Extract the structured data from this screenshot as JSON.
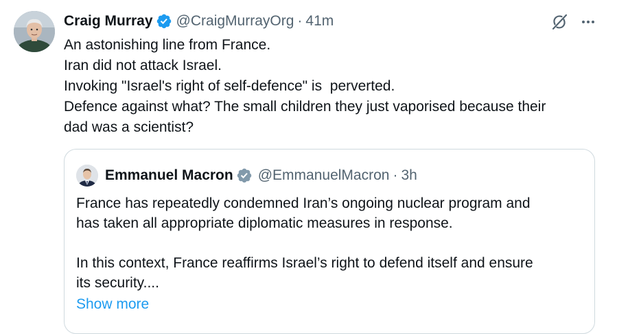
{
  "tweet": {
    "author_name": "Craig Murray",
    "author_handle": "@CraigMurrayOrg",
    "separator": "·",
    "time": "41m",
    "text_lines": [
      "An astonishing line from France.",
      "Iran did not attack Israel.",
      "Invoking \"Israel's right of self-defence\" is  perverted.",
      "Defence against what? The small children they just vaporised because their",
      "dad was a scientist?"
    ],
    "icons": {
      "verified": "verified-badge-icon",
      "grok": "grok-icon",
      "more": "more-options-icon"
    }
  },
  "quote": {
    "author_name": "Emmanuel Macron",
    "author_handle": "@EmmanuelMacron",
    "separator": "·",
    "time": "3h",
    "text_lines_p1": [
      "France has repeatedly condemned Iran’s ongoing nuclear program and",
      "has taken all appropriate diplomatic measures in response."
    ],
    "text_lines_p2": [
      "In this context, France reaffirms Israel’s right to defend itself and ensure",
      "its security...."
    ],
    "show_more_label": "Show more",
    "icons": {
      "verified": "gray-verified-badge-icon"
    }
  },
  "colors": {
    "text_primary": "#0f1419",
    "text_secondary": "#536471",
    "link_blue": "#1d9bf0",
    "verified_blue": "#1d9bf0",
    "verified_gray": "#829aab",
    "border": "#cfd9de"
  }
}
